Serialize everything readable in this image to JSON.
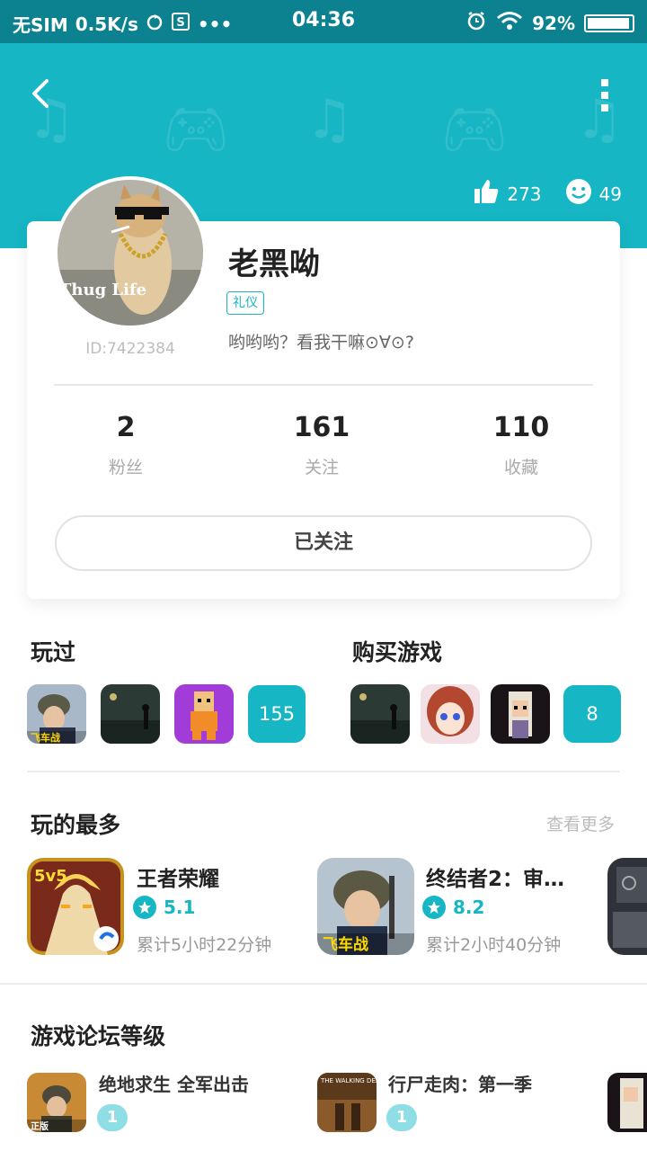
{
  "status_bar": {
    "carrier": "无SIM",
    "speed": "0.5K/s",
    "time": "04:36",
    "battery": "92%",
    "battery_level": 0.92
  },
  "header": {
    "likes": "273",
    "smiles": "49"
  },
  "profile": {
    "username": "老黑呦",
    "tag": "礼仪",
    "bio": "哟哟哟？看我干嘛⊙∀⊙?",
    "user_id": "ID:7422384",
    "avatar_text": "Thug Life",
    "followers_count": "2",
    "followers_label": "粉丝",
    "following_count": "161",
    "following_label": "关注",
    "favorites_count": "110",
    "favorites_label": "收藏",
    "follow_button": "已关注"
  },
  "played": {
    "title": "玩过",
    "more_count": "155",
    "icon_badge": "飞车战"
  },
  "purchased": {
    "title": "购买游戏",
    "more_count": "8"
  },
  "most_played": {
    "title": "玩的最多",
    "see_more": "查看更多",
    "games": [
      {
        "name": "王者荣耀",
        "rating": "5.1",
        "playtime": "累计5小时22分钟",
        "icon_badge": "5v5"
      },
      {
        "name": "终结者2：审…",
        "rating": "8.2",
        "playtime": "累计2小时40分钟",
        "icon_badge": "飞车战"
      }
    ]
  },
  "forum": {
    "title": "游戏论坛等级",
    "items": [
      {
        "name": "绝地求生 全军出击",
        "level": "1",
        "icon_badge": "正版"
      },
      {
        "name": "行尸走肉：第一季",
        "level": "1",
        "icon_text": "THE WALKING DEAD"
      }
    ]
  },
  "colors": {
    "accent": "#16b6c4",
    "status_bar": "#0c8290"
  }
}
